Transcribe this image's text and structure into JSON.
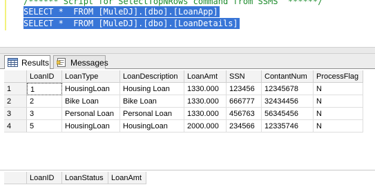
{
  "editor": {
    "comment": "/****** Script for SelectTopNRows command from SSMS  ******/",
    "lines": [
      "SELECT *  FROM [MuleDJ].[dbo].[LoanApp]",
      "SELECT *  FROM [MuleDJ].[dbo].[LoanDetails]"
    ]
  },
  "tabs": {
    "results": "Results",
    "messages": "Messages"
  },
  "grid1": {
    "columns": [
      "LoanID",
      "LoanType",
      "LoanDescription",
      "LoanAmt",
      "SSN",
      "ContantNum",
      "ProcessFlag"
    ],
    "rows": [
      {
        "n": "1",
        "cells": [
          "1",
          "HousingLoan",
          "Housing Loan",
          "1330.000",
          "123456",
          "12345678",
          "N"
        ]
      },
      {
        "n": "2",
        "cells": [
          "2",
          "Bike Loan",
          "Bike Loan",
          "1330.000",
          "666777",
          "32434456",
          "N"
        ]
      },
      {
        "n": "3",
        "cells": [
          "3",
          "Personal Loan",
          "Personal Loan",
          "1330.000",
          "456763",
          "56345456",
          "N"
        ]
      },
      {
        "n": "4",
        "cells": [
          "5",
          "HousingLoan",
          "HousingLoan",
          "2000.000",
          "234566",
          "12335746",
          "N"
        ]
      }
    ]
  },
  "grid2": {
    "columns": [
      "LoanID",
      "LoanStatus",
      "LoanAmt"
    ]
  }
}
